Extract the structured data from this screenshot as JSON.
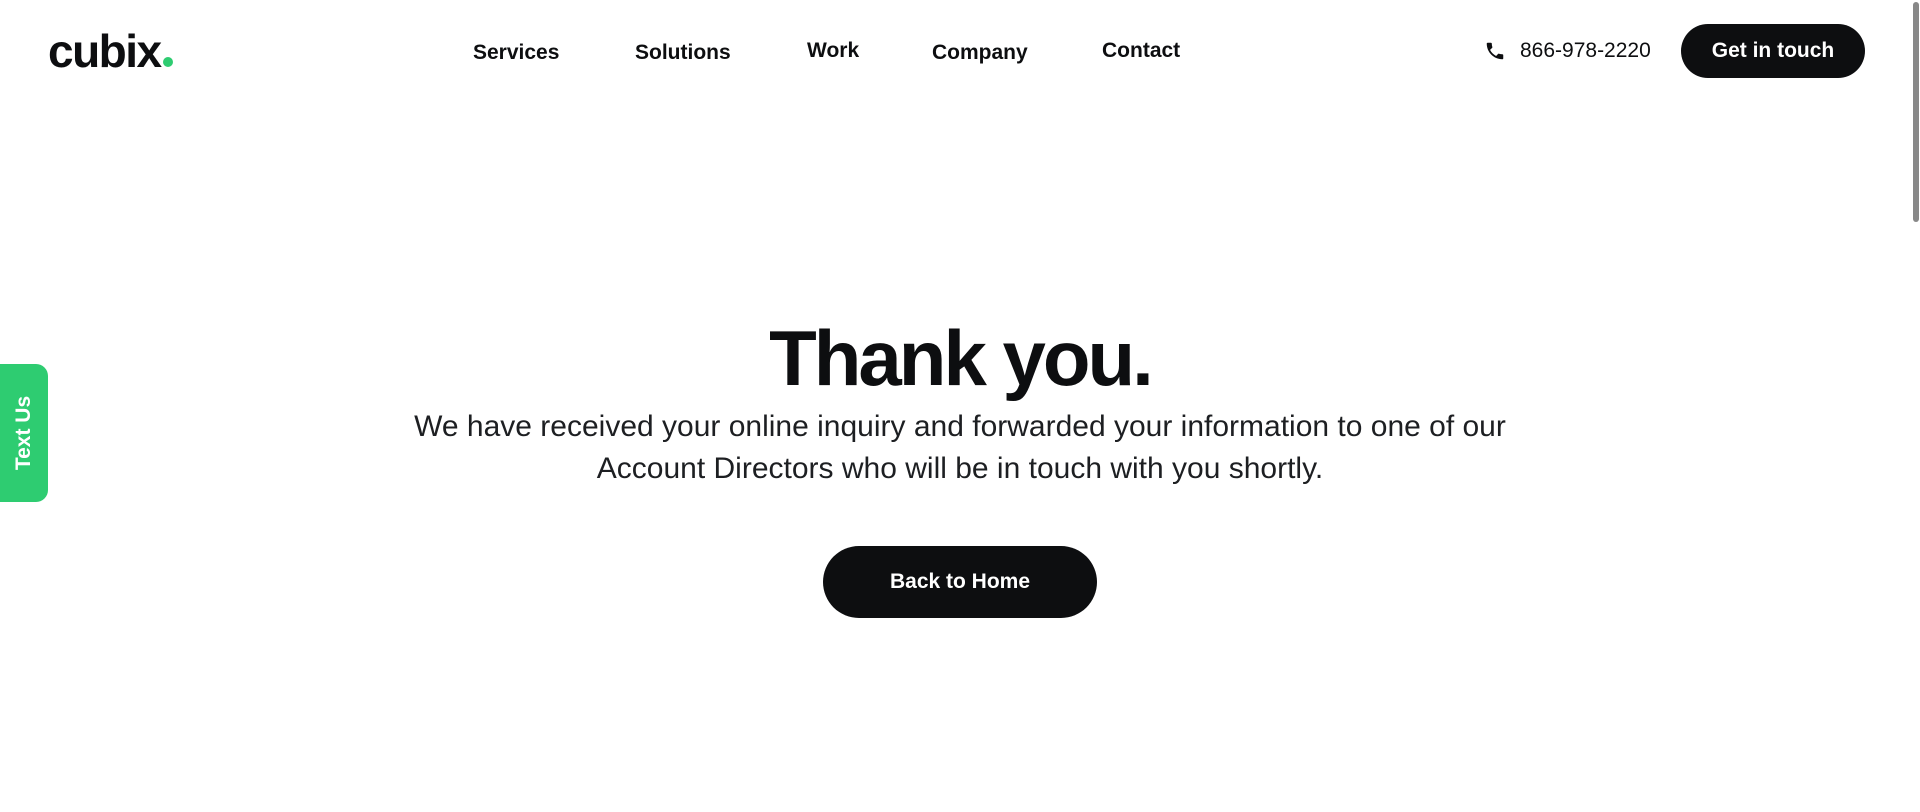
{
  "brand": {
    "logo_text": "cubix",
    "accent_color": "#2ecc71",
    "dark_color": "#0d0e10"
  },
  "nav": {
    "items": [
      {
        "label": "Services"
      },
      {
        "label": "Solutions"
      },
      {
        "label": "Work"
      },
      {
        "label": "Company"
      },
      {
        "label": "Contact"
      }
    ]
  },
  "header": {
    "phone_icon": "phone-icon",
    "phone_number": "866-978-2220",
    "cta_label": "Get in touch"
  },
  "side_tab": {
    "label": "Text Us"
  },
  "main": {
    "title": "Thank you.",
    "message": "We have received your online inquiry and forwarded your information to one of our Account Directors who will be in touch with you shortly.",
    "button_label": "Back to Home"
  }
}
